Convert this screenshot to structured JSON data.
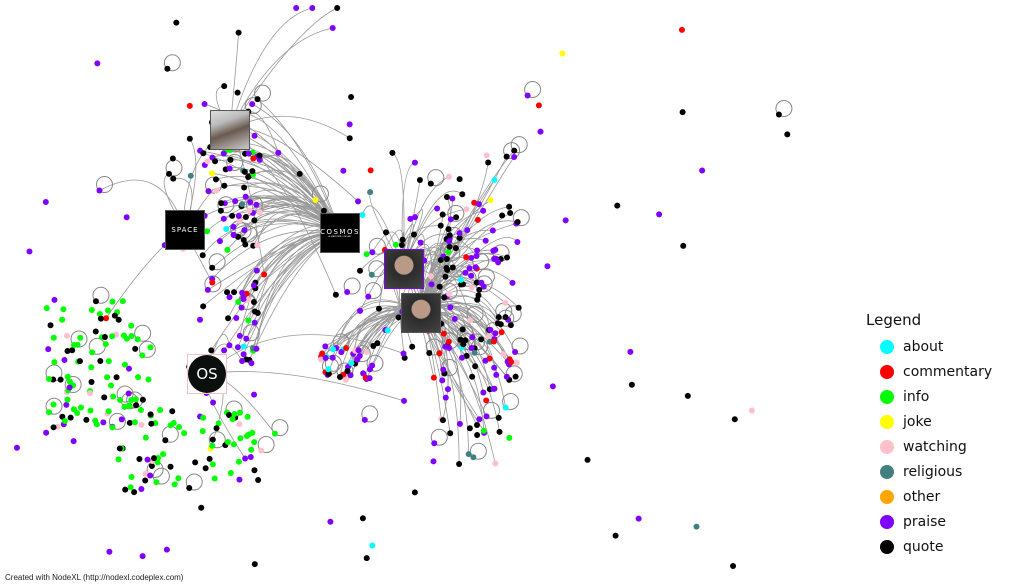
{
  "legend": {
    "title": "Legend",
    "items": [
      {
        "label": "about",
        "color": "#00ffff"
      },
      {
        "label": "commentary",
        "color": "#ff0000"
      },
      {
        "label": "info",
        "color": "#00ff00"
      },
      {
        "label": "joke",
        "color": "#ffff00"
      },
      {
        "label": "watching",
        "color": "#ffc0cb"
      },
      {
        "label": "religious",
        "color": "#408080"
      },
      {
        "label": "other",
        "color": "#ffa500"
      },
      {
        "label": "praise",
        "color": "#8000ff"
      },
      {
        "label": "quote",
        "color": "#000000"
      }
    ]
  },
  "hubs": {
    "space_logo": "SPACE",
    "cosmos_logo": "COSMOS",
    "cosmos_subtitle": "A SPACETIME ODYSSEY",
    "os_logo": "OS"
  },
  "edge_color": "#999999",
  "footer": "Created with NodeXL (http://nodexl.codeplex.com)"
}
